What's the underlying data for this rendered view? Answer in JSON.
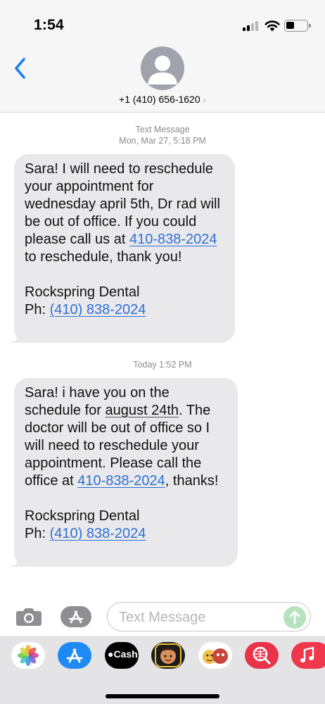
{
  "status": {
    "time": "1:54"
  },
  "header": {
    "contact": "+1 (410) 656-1620"
  },
  "thread": {
    "stamp1_type": "Text Message",
    "stamp1_time": "Mon, Mar 27, 5:18 PM",
    "msg1": {
      "text_a": "Sara! I will need to reschedule your appointment for wednesday april 5th, Dr rad will be out of office. If you could please call us at ",
      "link_a": "410-838-2024",
      "text_b": " to reschedule, thank you!",
      "sig": "Rockspring Dental",
      "ph_label": "Ph: ",
      "ph_link": "(410) 838-2024"
    },
    "stamp2": "Today 1:52 PM",
    "msg2": {
      "text_a": "Sara! i have you on the schedule for ",
      "date": "august 24th",
      "text_b": ". The doctor will be out of office so I will need to reschedule your appointment. Please call the office at ",
      "link_a": "410-838-2024",
      "text_c": ", thanks!",
      "sig": "Rockspring Dental",
      "ph_label": "Ph: ",
      "ph_link": "(410) 838-2024"
    }
  },
  "compose": {
    "placeholder": "Text Message"
  },
  "drawer": {
    "apps": [
      {
        "name": "photos-icon",
        "color": "#ffffff"
      },
      {
        "name": "app-store-icon",
        "color": "#1e8af6"
      },
      {
        "name": "apple-cash-icon",
        "label": "Cash",
        "color": "#000000"
      },
      {
        "name": "memoji-icon",
        "color": "#1c1c1e"
      },
      {
        "name": "animoji-icon",
        "color": "#ffffff"
      },
      {
        "name": "web-search-icon",
        "color": "#e8334a"
      },
      {
        "name": "music-icon",
        "color": "#f0374b"
      }
    ]
  },
  "colors": {
    "link": "#2e6fd6",
    "bubble": "#e9e9eb",
    "accent": "#007aff"
  }
}
